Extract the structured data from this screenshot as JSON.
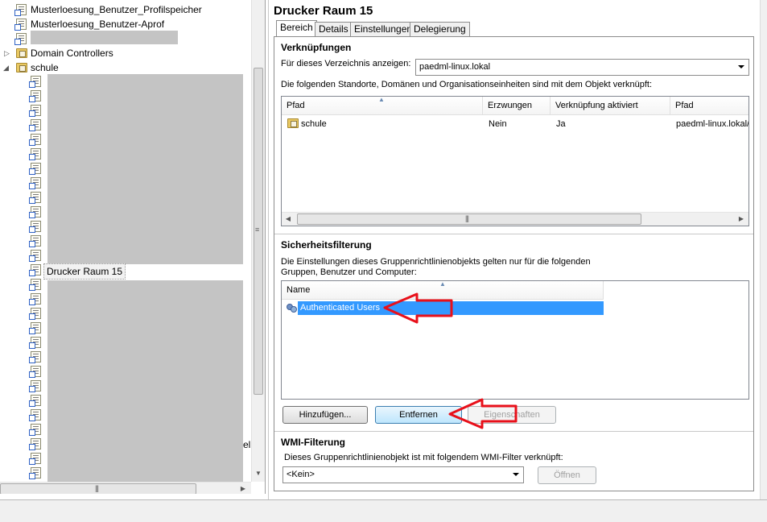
{
  "tree": {
    "items": [
      {
        "label": "Musterloesung_Benutzer_Profilspeicher"
      },
      {
        "label": "Musterloesung_Benutzer-Aprof"
      },
      {
        "label": ""
      },
      {
        "label": "Domain Controllers"
      },
      {
        "label": "schule"
      }
    ],
    "selected_item": "Drucker Raum 15",
    "truncated_suffix": "el"
  },
  "gpo": {
    "title": "Drucker Raum 15",
    "tabs": [
      {
        "label": "Bereich",
        "active": true
      },
      {
        "label": "Details",
        "active": false
      },
      {
        "label": "Einstellungen",
        "active": false
      },
      {
        "label": "Delegierung",
        "active": false
      }
    ]
  },
  "links": {
    "heading": "Verknüpfungen",
    "directory_label": "Für dieses Verzeichnis anzeigen:",
    "directory_value": "paedml-linux.lokal",
    "description": "Die folgenden Standorte, Domänen und Organisationseinheiten sind mit dem Objekt verknüpft:",
    "columns": [
      "Pfad",
      "Erzwungen",
      "Verknüpfung aktiviert",
      "Pfad"
    ],
    "rows": [
      {
        "location": "schule",
        "enforced": "Nein",
        "enabled": "Ja",
        "path": "paedml-linux.lokal/s"
      }
    ]
  },
  "security": {
    "heading": "Sicherheitsfilterung",
    "description_line1": "Die Einstellungen dieses Gruppenrichtlinienobjekts gelten nur für die folgenden",
    "description_line2": "Gruppen, Benutzer und Computer:",
    "column": "Name",
    "rows": [
      {
        "name": "Authenticated Users",
        "selected": true
      }
    ],
    "buttons": {
      "add": "Hinzufügen...",
      "remove": "Entfernen",
      "properties": "Eigenschaften"
    }
  },
  "wmi": {
    "heading": "WMI-Filterung",
    "description": "Dieses Gruppenrichtlinienobjekt ist mit folgendem WMI-Filter verknüpft:",
    "filter_value": "<Kein>",
    "open_button": "Öffnen"
  },
  "colors": {
    "selection": "#3399ff",
    "annotation_arrow": "#e8101a",
    "redaction": "#c4c4c4"
  }
}
